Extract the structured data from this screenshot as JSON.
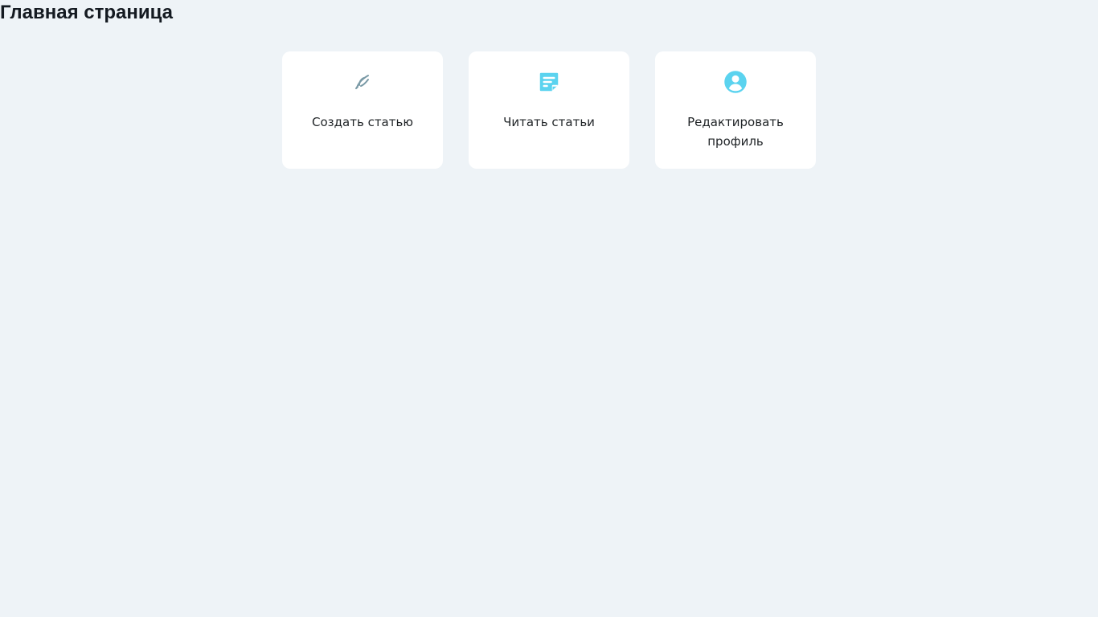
{
  "page": {
    "title": "Главная страница"
  },
  "cards": [
    {
      "label": "Создать статью",
      "icon": "quill-icon",
      "icon_color": "#7a9aa6"
    },
    {
      "label": "Читать статьи",
      "icon": "note-icon",
      "icon_color": "#5bd3ef"
    },
    {
      "label": "Редактировать профиль",
      "icon": "user-circle-icon",
      "icon_color": "#5bd3ef"
    }
  ],
  "colors": {
    "background": "#eef3f7",
    "card": "#ffffff",
    "accent": "#5bd3ef",
    "muted_icon": "#7a9aa6"
  }
}
